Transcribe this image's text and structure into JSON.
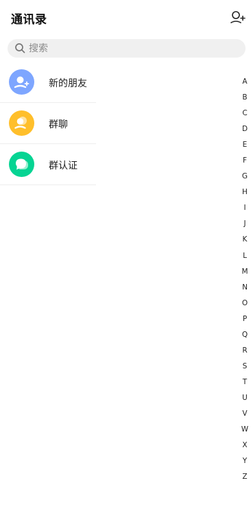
{
  "header": {
    "title": "通讯录",
    "add_icon": "add-person-icon"
  },
  "search": {
    "placeholder": "搜索",
    "icon": "search-icon"
  },
  "items": [
    {
      "label": "新的朋友",
      "icon": "new-friend-icon",
      "color": "#7ea6ff"
    },
    {
      "label": "群聊",
      "icon": "group-chat-icon",
      "color": "#ffbf2b"
    },
    {
      "label": "群认证",
      "icon": "group-verify-icon",
      "color": "#06d493"
    }
  ],
  "index": [
    "A",
    "B",
    "C",
    "D",
    "E",
    "F",
    "G",
    "H",
    "I",
    "J",
    "K",
    "L",
    "M",
    "N",
    "O",
    "P",
    "Q",
    "R",
    "S",
    "T",
    "U",
    "V",
    "W",
    "X",
    "Y",
    "Z"
  ]
}
